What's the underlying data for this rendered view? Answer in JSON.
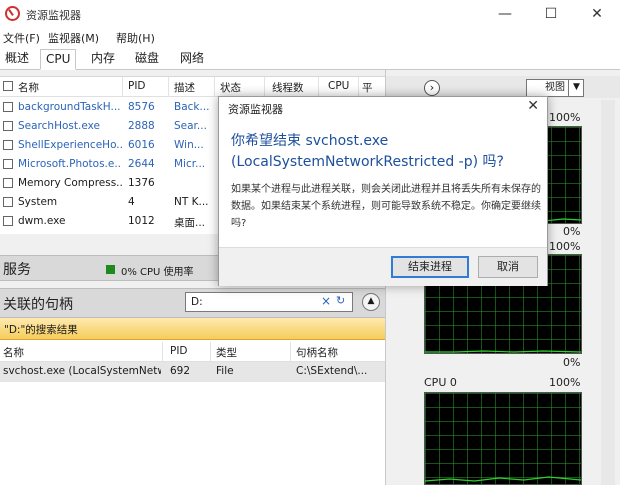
{
  "window": {
    "title": "资源监视器"
  },
  "menu": [
    "文件(F)",
    "监视器(M)",
    "帮助(H)"
  ],
  "tabs": [
    "概述",
    "CPU",
    "内存",
    "磁盘",
    "网络"
  ],
  "process_table": {
    "headers": [
      "名称",
      "PID",
      "描述",
      "状态",
      "线程数",
      "CPU",
      "平"
    ],
    "rows": [
      {
        "name": "backgroundTaskH...",
        "pid": "8576",
        "desc": "Back...",
        "blue": true
      },
      {
        "name": "SearchHost.exe",
        "pid": "2888",
        "desc": "Sear...",
        "blue": true
      },
      {
        "name": "ShellExperienceHo...",
        "pid": "6016",
        "desc": "Win...",
        "blue": true
      },
      {
        "name": "Microsoft.Photos.e...",
        "pid": "2644",
        "desc": "Micr...",
        "blue": true
      },
      {
        "name": "Memory Compress...",
        "pid": "1376",
        "desc": "",
        "blue": false
      },
      {
        "name": "System",
        "pid": "4",
        "desc": "NT K...",
        "blue": false
      },
      {
        "name": "dwm.exe",
        "pid": "1012",
        "desc": "桌面...",
        "blue": false
      }
    ]
  },
  "services": {
    "title": "服务",
    "cpu_usage": "0% CPU 使用率"
  },
  "handles": {
    "title": "关联的句柄",
    "search_value": "D:",
    "results_label": "\"D:\"的搜索结果",
    "headers": [
      "名称",
      "PID",
      "类型",
      "句柄名称"
    ],
    "row": {
      "name": "svchost.exe (LocalSystemNetw...",
      "pid": "692",
      "type": "File",
      "handle_name": "C:\\SExtend\\..."
    }
  },
  "right_panel": {
    "view_label": "视图",
    "graph1": {
      "top_label": "100%",
      "bottom_label": "0%"
    },
    "graph2": {
      "top_label": "100%",
      "bottom_label": "0%"
    },
    "graph3": {
      "name": "CPU 0",
      "top_label": "100%"
    }
  },
  "dialog": {
    "title": "资源监视器",
    "heading": "你希望结束 svchost.exe (LocalSystemNetworkRestricted -p) 吗?",
    "body": "如果某个进程与此进程关联，则会关闭此进程并且将丢失所有未保存的数据。如果结束某个系统进程，则可能导致系统不稳定。你确定要继续吗?",
    "confirm_label": "结束进程",
    "cancel_label": "取消"
  }
}
